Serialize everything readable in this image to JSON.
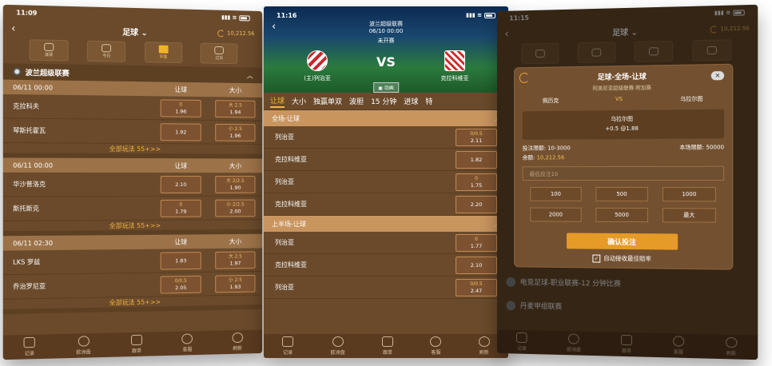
{
  "phone1": {
    "time": "11:09",
    "nav_title": "足球",
    "balance": "10,212.56",
    "tabs": [
      "滚球",
      "今日",
      "早盘",
      "过关"
    ],
    "league": "波兰超级联赛",
    "matches": [
      {
        "date": "06/11 00:00",
        "col1": "让球",
        "col2": "大小",
        "teams": [
          {
            "name": "克拉科夫",
            "o1h": "0",
            "o1": "1.96",
            "o2h": "大 2.5",
            "o2": "1.94"
          },
          {
            "name": "琴斯托霍瓦",
            "o1h": "",
            "o1": "1.92",
            "o2h": "小 2.5",
            "o2": "1.96"
          }
        ],
        "more": "全部玩法 55+>>"
      },
      {
        "date": "06/11 00:00",
        "col1": "让球",
        "col2": "大小",
        "teams": [
          {
            "name": "华沙普洛克",
            "o1h": "",
            "o1": "2.10",
            "o2h": "大 2/2.5",
            "o2": "1.90"
          },
          {
            "name": "斯托斯克",
            "o1h": "0",
            "o1": "1.79",
            "o2h": "小 2/2.5",
            "o2": "2.00"
          }
        ],
        "more": "全部玩法 55+>>"
      },
      {
        "date": "06/11 02:30",
        "col1": "让球",
        "col2": "大小",
        "teams": [
          {
            "name": "LKS 罗兹",
            "o1h": "",
            "o1": "1.83",
            "o2h": "大 2.5",
            "o2": "1.97"
          },
          {
            "name": "乔治罗尼亚",
            "o1h": "0/0.5",
            "o1": "2.05",
            "o2h": "小 2.5",
            "o2": "1.93"
          }
        ],
        "more": "全部玩法 55+>>"
      }
    ]
  },
  "bottom_nav": [
    "记录",
    "欧洲盘",
    "跟单",
    "客服",
    "刷新"
  ],
  "phone2": {
    "time": "11:16",
    "league": "波兰超级联赛",
    "datetime": "06/10 00:00",
    "status": "未开赛",
    "home": "(主)列治亚",
    "away": "克拉科维亚",
    "vs": "VS",
    "anim": "动画",
    "tabs": [
      "让球",
      "大小",
      "独赢单双",
      "波胆",
      "15 分钟",
      "进球",
      "特"
    ],
    "sections": [
      {
        "title": "全场-让球",
        "rows": [
          {
            "name": "列治亚",
            "h": "0/0.5",
            "v": "2.11"
          },
          {
            "name": "克拉科维亚",
            "h": "",
            "v": "1.82"
          },
          {
            "name": "列治亚",
            "h": "0",
            "v": "1.75"
          },
          {
            "name": "克拉科维亚",
            "h": "",
            "v": "2.20"
          }
        ]
      },
      {
        "title": "上半场-让球",
        "rows": [
          {
            "name": "列治亚",
            "h": "0",
            "v": "1.77"
          },
          {
            "name": "克拉科维亚",
            "h": "",
            "v": "2.10"
          },
          {
            "name": "列治亚",
            "h": "0/0.5",
            "v": "2.47"
          }
        ]
      }
    ]
  },
  "phone3": {
    "time": "11:15",
    "nav_title": "足球",
    "balance": "10,212.56",
    "modal": {
      "title": "足球-全场-让球",
      "subtitle": "阿美尼亚超级联赛-附加赛",
      "home": "佩历克",
      "vs": "VS",
      "away": "乌拉尔图",
      "sel_team": "乌拉尔图",
      "sel_odds": "+0.5 @1.88",
      "limit_label": "投注限额: 10-3000",
      "field_limit": "本场限额: 50000",
      "balance_label": "余额:",
      "balance": "10,212.56",
      "placeholder": "最低投注10",
      "chips": [
        "100",
        "500",
        "1000",
        "2000",
        "5000",
        "最大"
      ],
      "confirm": "确认投注",
      "auto": "自动接收最佳赔率"
    },
    "bg_rows": [
      "电竞足球-职业联赛-12 分钟比赛",
      "丹麦甲组联赛"
    ]
  }
}
